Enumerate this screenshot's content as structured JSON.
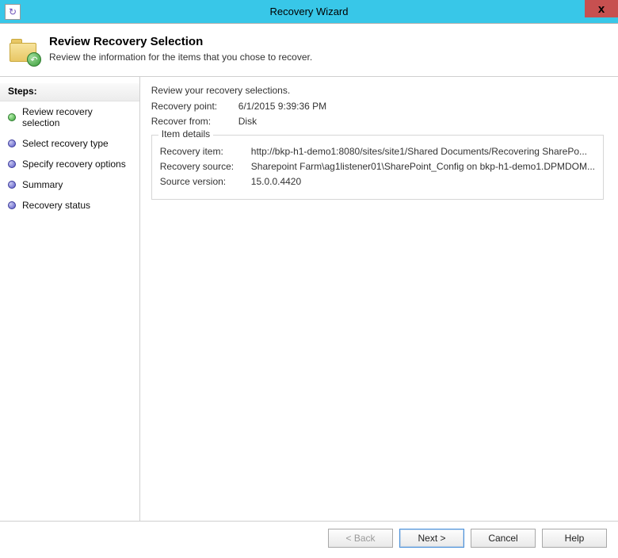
{
  "window": {
    "title": "Recovery Wizard",
    "close_label": "x"
  },
  "header": {
    "title": "Review Recovery Selection",
    "subtitle": "Review the information for the items that you chose to recover."
  },
  "sidebar": {
    "heading": "Steps:",
    "items": [
      {
        "label": "Review recovery selection",
        "state": "current"
      },
      {
        "label": "Select recovery type",
        "state": "pending"
      },
      {
        "label": "Specify recovery options",
        "state": "pending"
      },
      {
        "label": "Summary",
        "state": "pending"
      },
      {
        "label": "Recovery status",
        "state": "pending"
      }
    ]
  },
  "content": {
    "intro": "Review your recovery selections.",
    "recovery_point_label": "Recovery point:",
    "recovery_point_value": "6/1/2015 9:39:36 PM",
    "recover_from_label": "Recover from:",
    "recover_from_value": "Disk",
    "item_details_legend": "Item details",
    "recovery_item_label": "Recovery item:",
    "recovery_item_value": "http://bkp-h1-demo1:8080/sites/site1/Shared Documents/Recovering SharePo...",
    "recovery_source_label": "Recovery source:",
    "recovery_source_value": "Sharepoint Farm\\ag1listener01\\SharePoint_Config on bkp-h1-demo1.DPMDOM...",
    "source_version_label": "Source version:",
    "source_version_value": "15.0.0.4420"
  },
  "footer": {
    "back_label": "< Back",
    "next_label": "Next >",
    "cancel_label": "Cancel",
    "help_label": "Help"
  }
}
